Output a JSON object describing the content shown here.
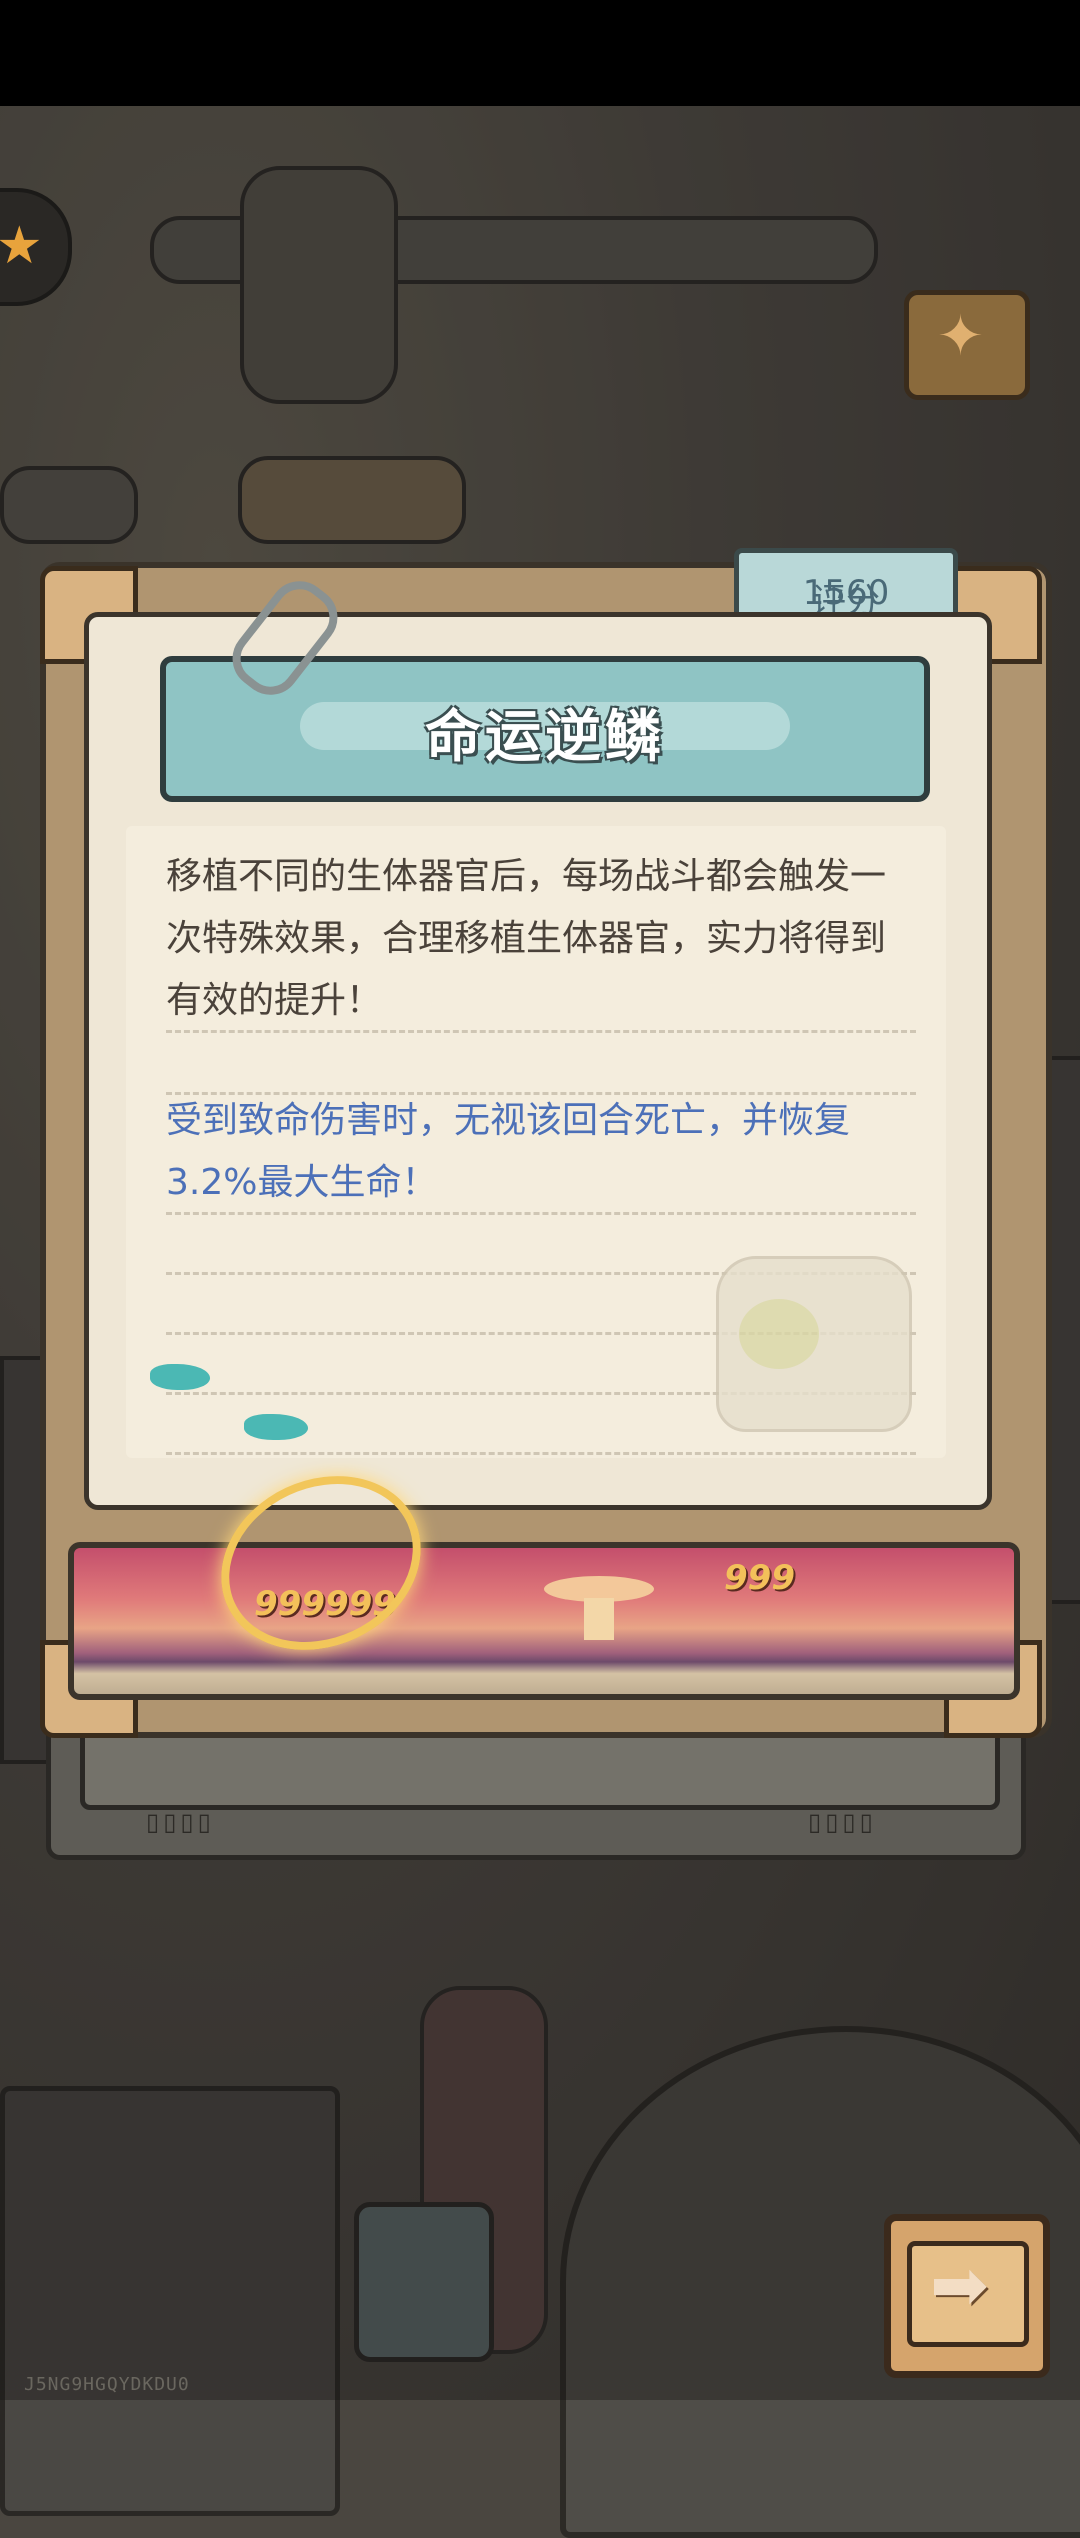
{
  "score": {
    "label": "评分",
    "value": "1560"
  },
  "card": {
    "title": "命运逆鳞",
    "description_lines": [
      "移植不同的生体器官后，每场战斗都会触发一",
      "次特殊效果，合理移植生体器官，实力将得到",
      "有效的提升！"
    ],
    "effect_lines": [
      "受到致命伤害时，无视该回合死亡，并恢复",
      "3.2%最大生命！"
    ]
  },
  "banner": {
    "damage_left": "999999",
    "damage_right": "999"
  },
  "watermark": "J5NG9HGQYDKDU0",
  "icons": {
    "avatar": "star-icon",
    "party": "party-popper-icon",
    "next": "arrow-right-icon",
    "clip": "paperclip-icon",
    "organ": "organ-jar-icon"
  },
  "colors": {
    "title_banner": "#8fc4c4",
    "effect_text": "#4c70b8",
    "paper": "#efe7d6"
  }
}
